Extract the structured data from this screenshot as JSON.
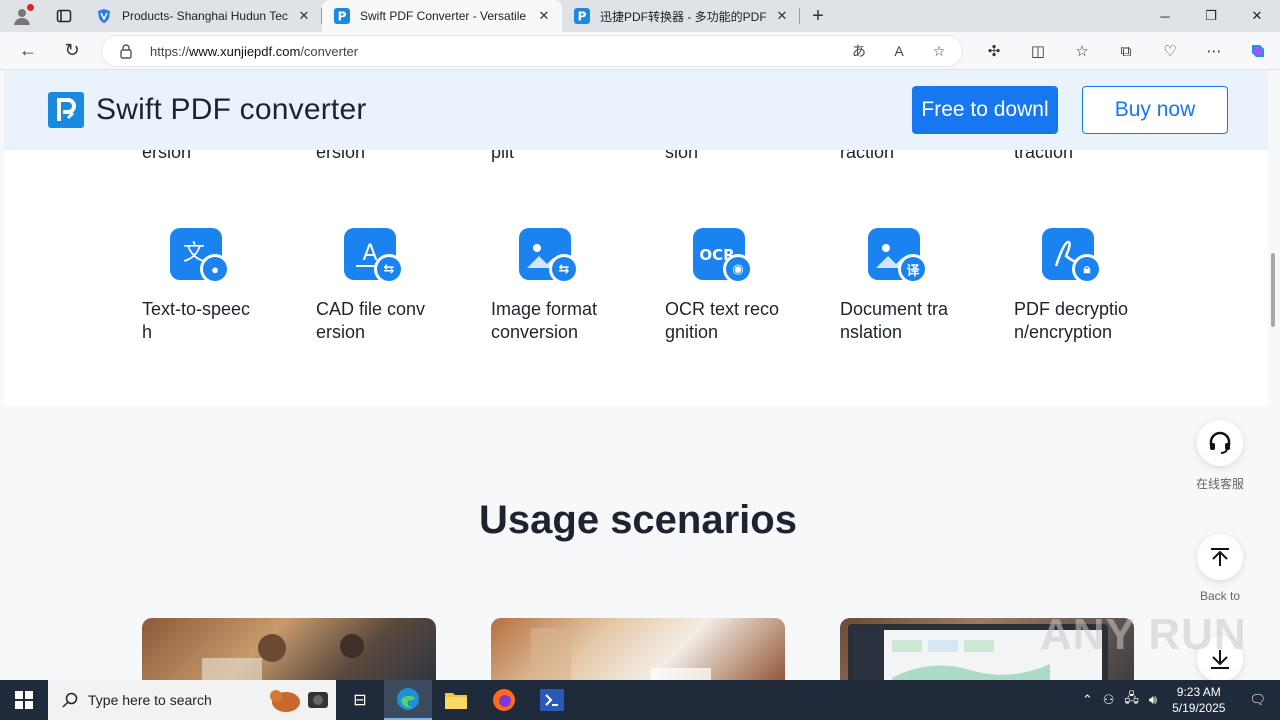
{
  "browser": {
    "tabs": [
      {
        "title": "Products- Shanghai Hudun Tech",
        "active": false
      },
      {
        "title": "Swift PDF Converter - Versatile PD",
        "active": true
      },
      {
        "title": "迅捷PDF转换器 - 多功能的PDF转",
        "active": false
      }
    ],
    "url_prefix": "https://",
    "url_host": "www.xunjiepdf.com",
    "url_path": "/converter"
  },
  "site": {
    "brand": "Swift PDF converter",
    "free_download_label": "Free to downl",
    "buy_label": "Buy now",
    "cut_labels": [
      "ersion",
      "ersion",
      "plit",
      "sion",
      "raction",
      "traction"
    ],
    "tools": [
      {
        "label": "Text-to-speech",
        "badge": "mic-icon"
      },
      {
        "label": "CAD file conversion",
        "badge": "swap-icon"
      },
      {
        "label": "Image format conversion",
        "badge": "swap-icon"
      },
      {
        "label": "OCR text recognition",
        "badge": "eye-icon"
      },
      {
        "label": "Document translation",
        "badge": "译"
      },
      {
        "label": "PDF decryption/encryption",
        "badge": "lock-icon"
      }
    ],
    "usage_title": "Usage scenarios",
    "float_service_label": "在线客服",
    "float_top_label": "Back to"
  },
  "watermark": "ANY RUN",
  "taskbar": {
    "search_placeholder": "Type here to search",
    "time": "9:23 AM",
    "date": "5/19/2025"
  },
  "colors": {
    "brand_blue": "#1677f0",
    "header_bg": "#eaf3fc",
    "taskbar_bg": "#1f2a3a"
  }
}
